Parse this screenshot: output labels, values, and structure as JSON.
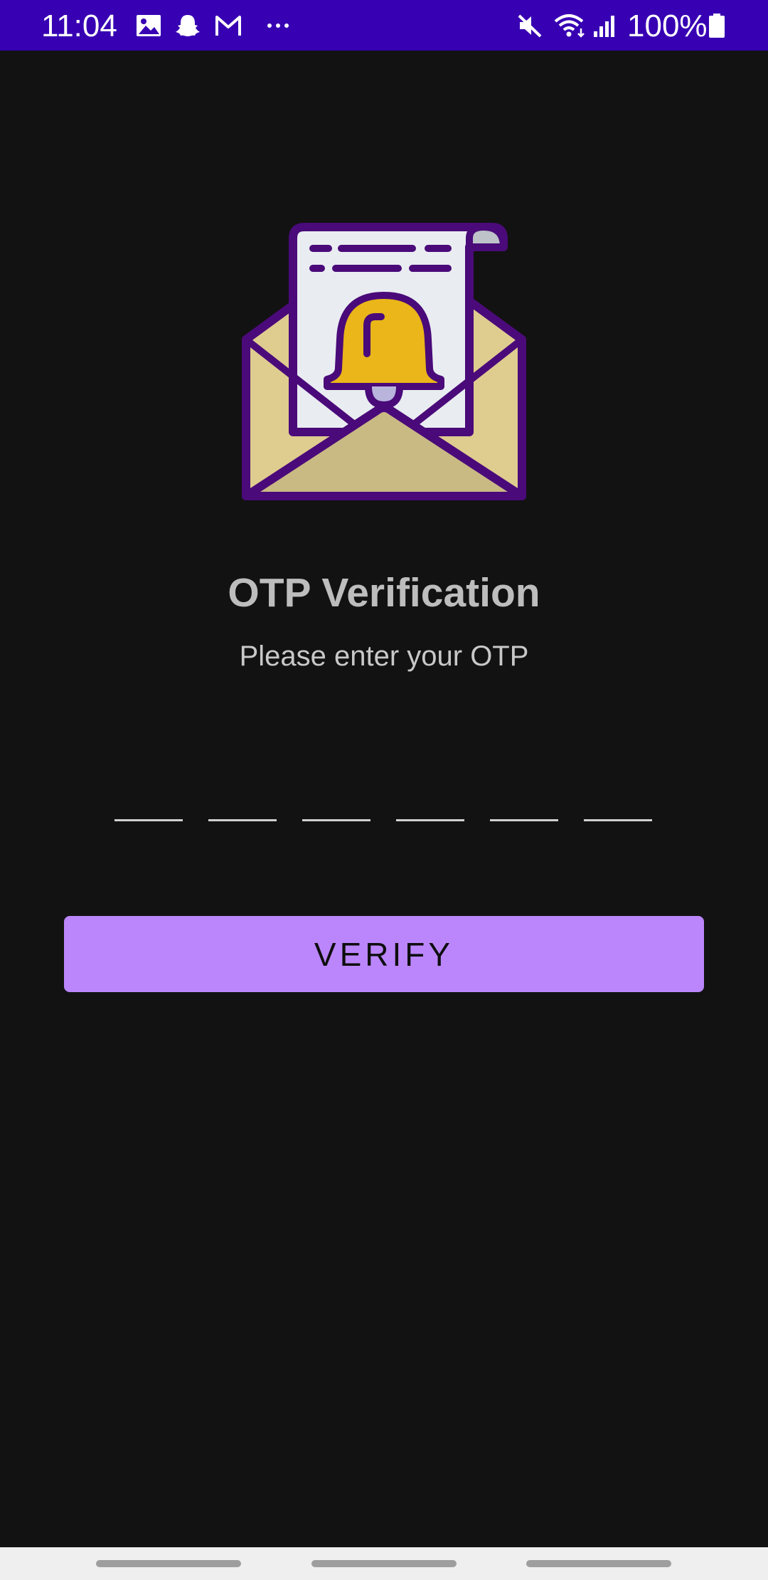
{
  "status_bar": {
    "time": "11:04",
    "notification_icons": [
      "image-icon",
      "snapchat-icon",
      "gmail-icon",
      "more-icon"
    ],
    "system_icons": [
      "mute-icon",
      "wifi-icon",
      "signal-icon",
      "battery-icon"
    ],
    "battery_percent": "100%",
    "background_color": "#3700b3"
  },
  "illustration": {
    "icon": "envelope-bell-icon"
  },
  "content": {
    "title": "OTP Verification",
    "subtitle": "Please enter your OTP"
  },
  "otp": {
    "digits": [
      "",
      "",
      "",
      "",
      "",
      ""
    ]
  },
  "actions": {
    "verify_label": "VERIFY",
    "accent_color": "#bb86fc"
  },
  "nav_bar": {
    "items": [
      "recent-apps",
      "home",
      "back"
    ]
  }
}
